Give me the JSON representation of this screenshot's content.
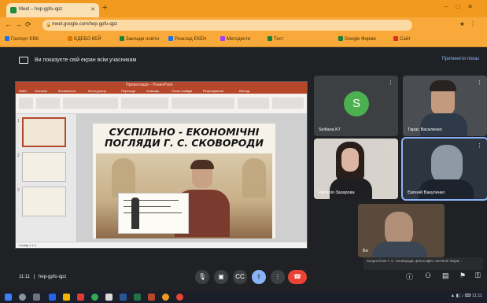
{
  "browser": {
    "tab_title": "Meet – hep-gpfu-qpz",
    "url": "meet.google.com/hep-gpfu-qpz",
    "bookmarks": [
      "Госпорт ЄВК",
      "ЄДЕБО КЕЙ",
      "Заклади освіти",
      "Розклад ЕКЕН",
      "Методисти",
      "Тест",
      "Google Форми",
      "Сайт"
    ]
  },
  "meet": {
    "presenting_text": "Ви показуєте свій екран всім учасникам",
    "stop_label": "Припинити показ",
    "meeting_time": "11:11",
    "meeting_code": "hep-gpfu-qpz",
    "caption_text": "Скоростіння Г. С. Сковороди, філософія, поетичні твори…"
  },
  "presentation": {
    "app_title": "Презентація – PowerPoint",
    "tabs": [
      "Файл",
      "Основне",
      "Вставлення",
      "Конструктор",
      "Переходи",
      "Анімація",
      "Показ слайдів",
      "Рецензування",
      "Вигляд"
    ],
    "slide_count": "Слайд 1 з 3",
    "slide_title_line1": "СУСПІЛЬНО - ЕКОНОМІЧНІ",
    "slide_title_line2": "ПОГЛЯДИ Г. С. СКОВОРОДИ"
  },
  "participants": [
    {
      "name": "Svitlana K7",
      "avatar_letter": "S"
    },
    {
      "name": "Тарас Василенко"
    },
    {
      "name": "Наталія Захарова"
    },
    {
      "name": "Євгеній Вакуленко"
    },
    {
      "name": "Ви"
    }
  ],
  "colors": {
    "chrome_orange": "#f29a1f",
    "meet_bg": "#202124",
    "powerpoint": "#b7472a",
    "hangup": "#ea4335",
    "accent_blue": "#8ab4f8"
  },
  "icons": [
    "mic-icon",
    "camera-icon",
    "captions-icon",
    "present-icon",
    "more-icon",
    "hangup-icon",
    "info-icon",
    "people-icon",
    "chat-icon",
    "activities-icon"
  ]
}
